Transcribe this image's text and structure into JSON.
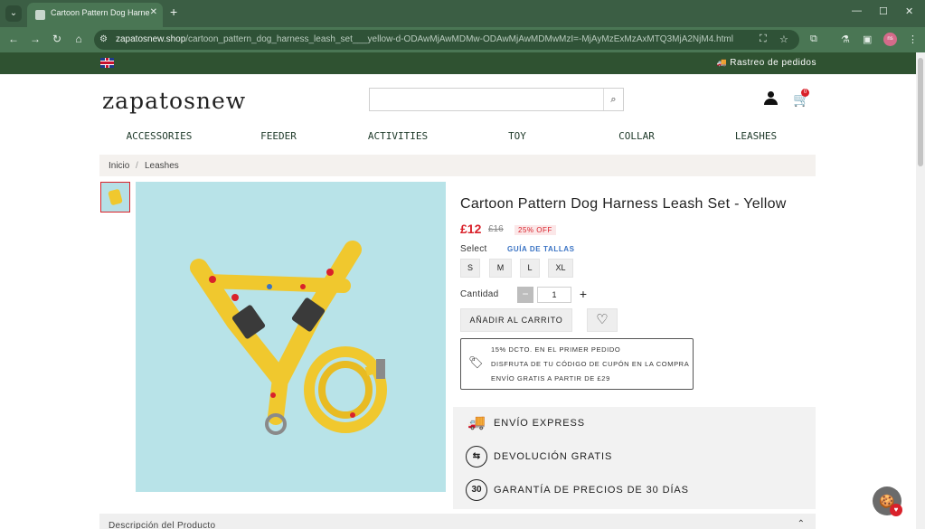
{
  "browser": {
    "tab_title": "Cartoon Pattern Dog Harness Le",
    "url_host": "zapatosnew.shop",
    "url_path": "/cartoon_pattern_dog_harness_leash_set___yellow-d-ODAwMjAwMDMw-ODAwMjAwMDMwMzI=-MjAyMzExMzAxMTQ3MjA2NjM4.html",
    "new_tab_icon": "+",
    "profile_label": "ns"
  },
  "topbar": {
    "language_flag": "uk-flag-icon",
    "tracking_label": "Rastreo de pedidos"
  },
  "header": {
    "logo_text": "zapatosnew",
    "search_placeholder": "",
    "cart_count": "0"
  },
  "categories": [
    "ACCESSORIES",
    "FEEDER",
    "ACTIVITIES",
    "TOY",
    "COLLAR",
    "LEASHES"
  ],
  "breadcrumb": {
    "home": "Inicio",
    "separator": "/",
    "current": "Leashes"
  },
  "product": {
    "title": "Cartoon Pattern Dog Harness Leash Set - Yellow",
    "price": "£12",
    "old_price": "£16",
    "discount": "25% OFF",
    "select_label": "Select",
    "size_guide": "GUÍA DE TALLAS",
    "sizes": [
      "S",
      "M",
      "L",
      "XL"
    ],
    "quantity_label": "Cantidad",
    "quantity": "1",
    "qty_minus": "−",
    "qty_plus": "+",
    "add_to_cart": "AÑADIR AL CARRITO"
  },
  "promo": {
    "line1": "15% DCTO. EN EL PRIMER PEDIDO",
    "line2": "DISFRUTA DE TU CÓDIGO DE CUPÓN EN LA COMPRA",
    "line3": "ENVÍO GRATIS A PARTIR DE £29"
  },
  "benefits": {
    "express": "ENVÍO EXPRESS",
    "returns": "DEVOLUCIÓN GRATIS",
    "guarantee": "GARANTÍA DE PRECIOS DE 30 DÍAS",
    "guarantee_icon_text": "30"
  },
  "description": {
    "label": "Descripción del Producto"
  },
  "colors": {
    "topbar": "#2f5231",
    "price_red": "#d9212a",
    "size_guide_blue": "#3a73c4",
    "browser_green": "#3b5e44"
  }
}
